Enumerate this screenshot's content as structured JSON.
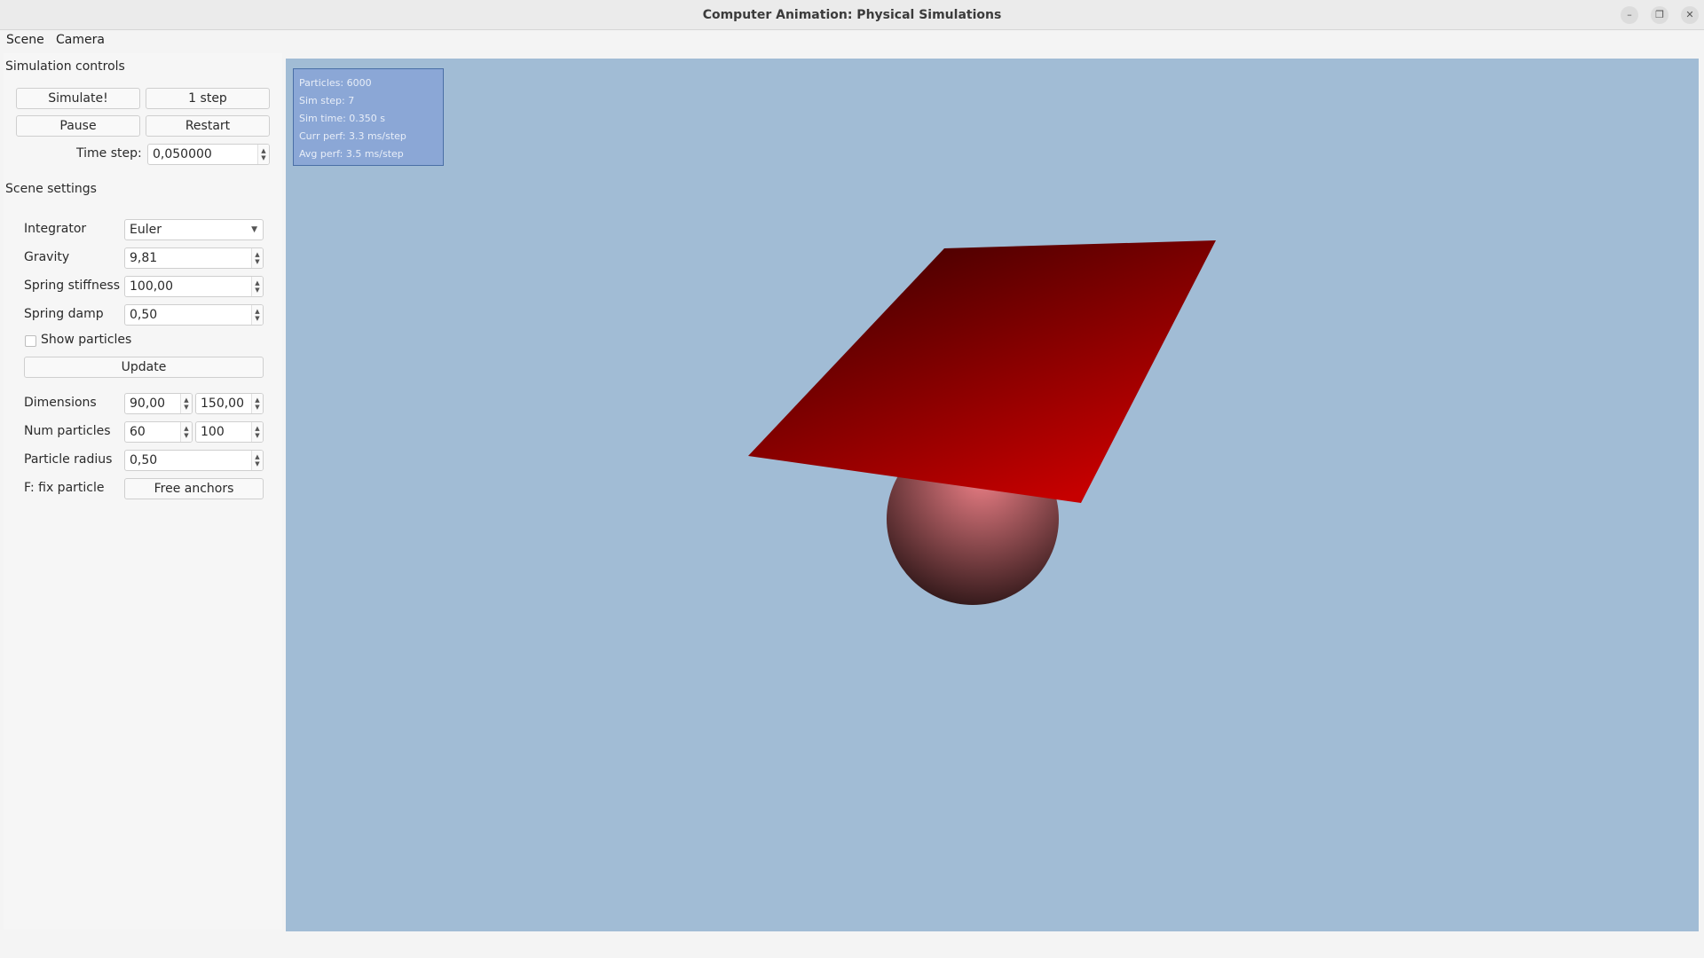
{
  "window": {
    "title": "Computer Animation: Physical Simulations",
    "buttons": [
      "–",
      "❐",
      "✕"
    ]
  },
  "menu": {
    "items": [
      "Scene",
      "Camera"
    ]
  },
  "simulation_controls": {
    "title": "Simulation controls",
    "simulate": "Simulate!",
    "step": "1 step",
    "pause": "Pause",
    "restart": "Restart",
    "time_step_label": "Time step:",
    "time_step_value": "0,050000"
  },
  "scene_settings": {
    "title": "Scene settings",
    "integrator_label": "Integrator",
    "integrator_value": "Euler",
    "gravity_label": "Gravity",
    "gravity_value": "9,81",
    "stiffness_label": "Spring stiffness",
    "stiffness_value": "100,00",
    "damp_label": "Spring damp",
    "damp_value": "0,50",
    "show_particles_label": "Show particles",
    "show_particles_checked": false,
    "update": "Update",
    "dimensions_label": "Dimensions",
    "dimensions_x": "90,00",
    "dimensions_y": "150,00",
    "num_particles_label": "Num particles",
    "num_particles_x": "60",
    "num_particles_y": "100",
    "radius_label": "Particle radius",
    "radius_value": "0,50",
    "fix_label": "F: fix particle",
    "free_anchors": "Free anchors"
  },
  "stats": {
    "particles": "Particles: 6000",
    "sim_step": "Sim step: 7",
    "sim_time": "Sim time: 0.350 s",
    "curr_perf": "Curr perf: 3.3 ms/step",
    "avg_perf": "Avg perf: 3.5 ms/step"
  },
  "colors": {
    "viewport_bg": "#a1bcd5",
    "cloth_dark": "#4d0000",
    "cloth_light": "#c60000",
    "sphere_light": "#ec7f86",
    "sphere_dark": "#2a1415"
  }
}
